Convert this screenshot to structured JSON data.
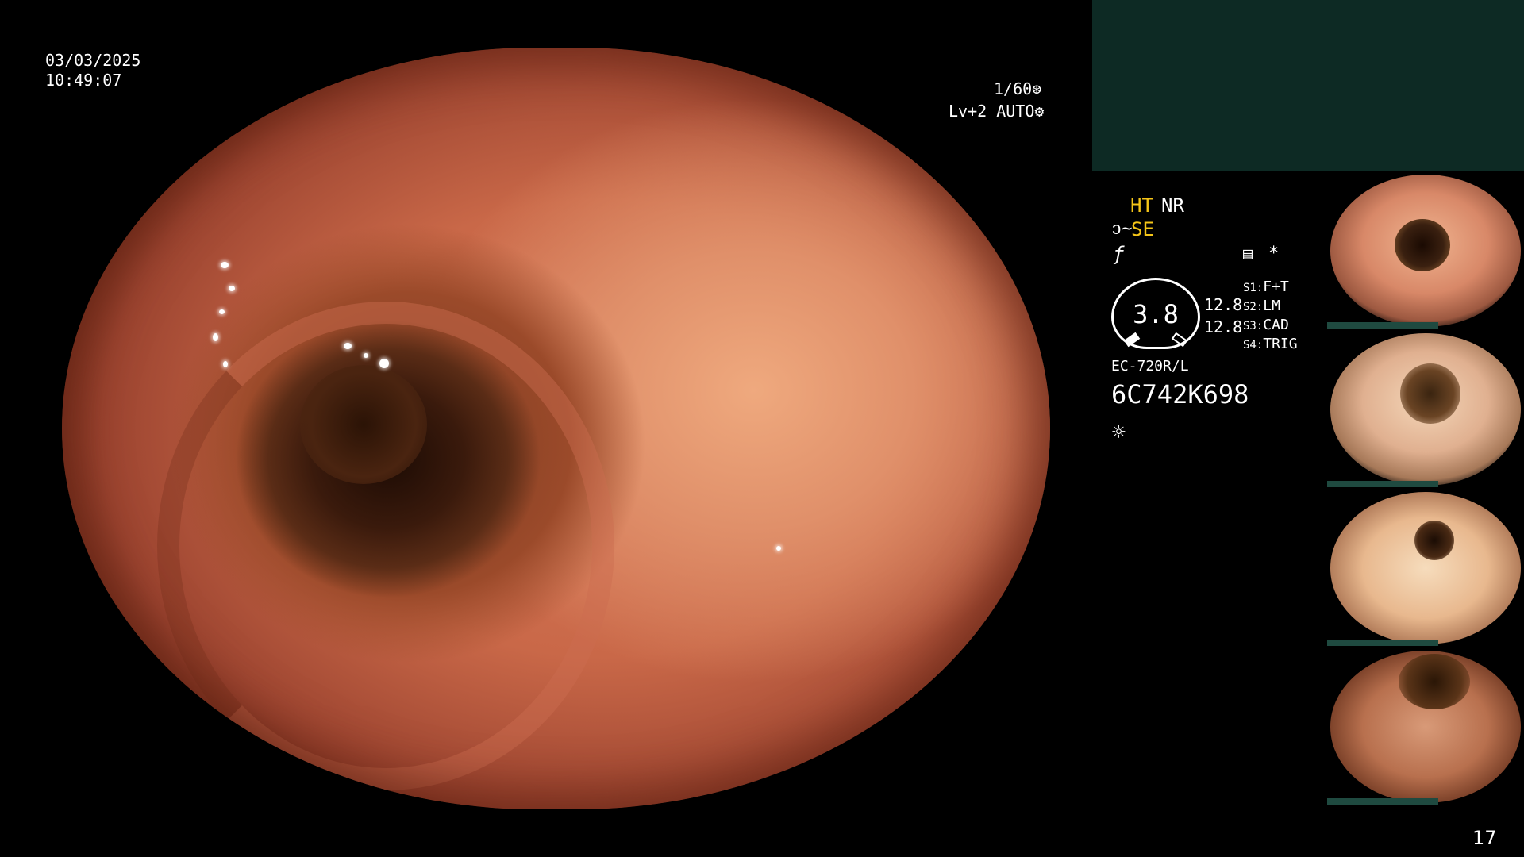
{
  "overlay": {
    "date": "03/03/2025",
    "time": "10:49:07",
    "shutter": "1/60",
    "shutter_icon": "aperture-icon",
    "level": "Lv+2 AUTO",
    "level_icon": "gear-circle-icon",
    "ht": "HT",
    "nr": "NR",
    "se": "SE",
    "se_icon": "scope-icon",
    "f_icon": "f-slash-icon",
    "memo_icon": "document-icon",
    "asterisk": "*",
    "gauge_value": "3.8",
    "val1": "12.8",
    "val2": "12.8",
    "s1_label": "S1:",
    "s1": "F+T",
    "s2_label": "S2:",
    "s2": "LM",
    "s3_label": "S3:",
    "s3": "CAD",
    "s4_label": "S4:",
    "s4": "TRIG",
    "scope_model": "EC-720R/L",
    "serial": "6C742K698",
    "light_icon": "sun-icon",
    "page_number": "17"
  },
  "colors": {
    "accent_yellow": "#f5c518",
    "panel_teal": "#0d2a24",
    "text": "#ffffff"
  },
  "thumbnails": [
    {
      "name": "thumbnail-1"
    },
    {
      "name": "thumbnail-2"
    },
    {
      "name": "thumbnail-3"
    },
    {
      "name": "thumbnail-4"
    }
  ]
}
